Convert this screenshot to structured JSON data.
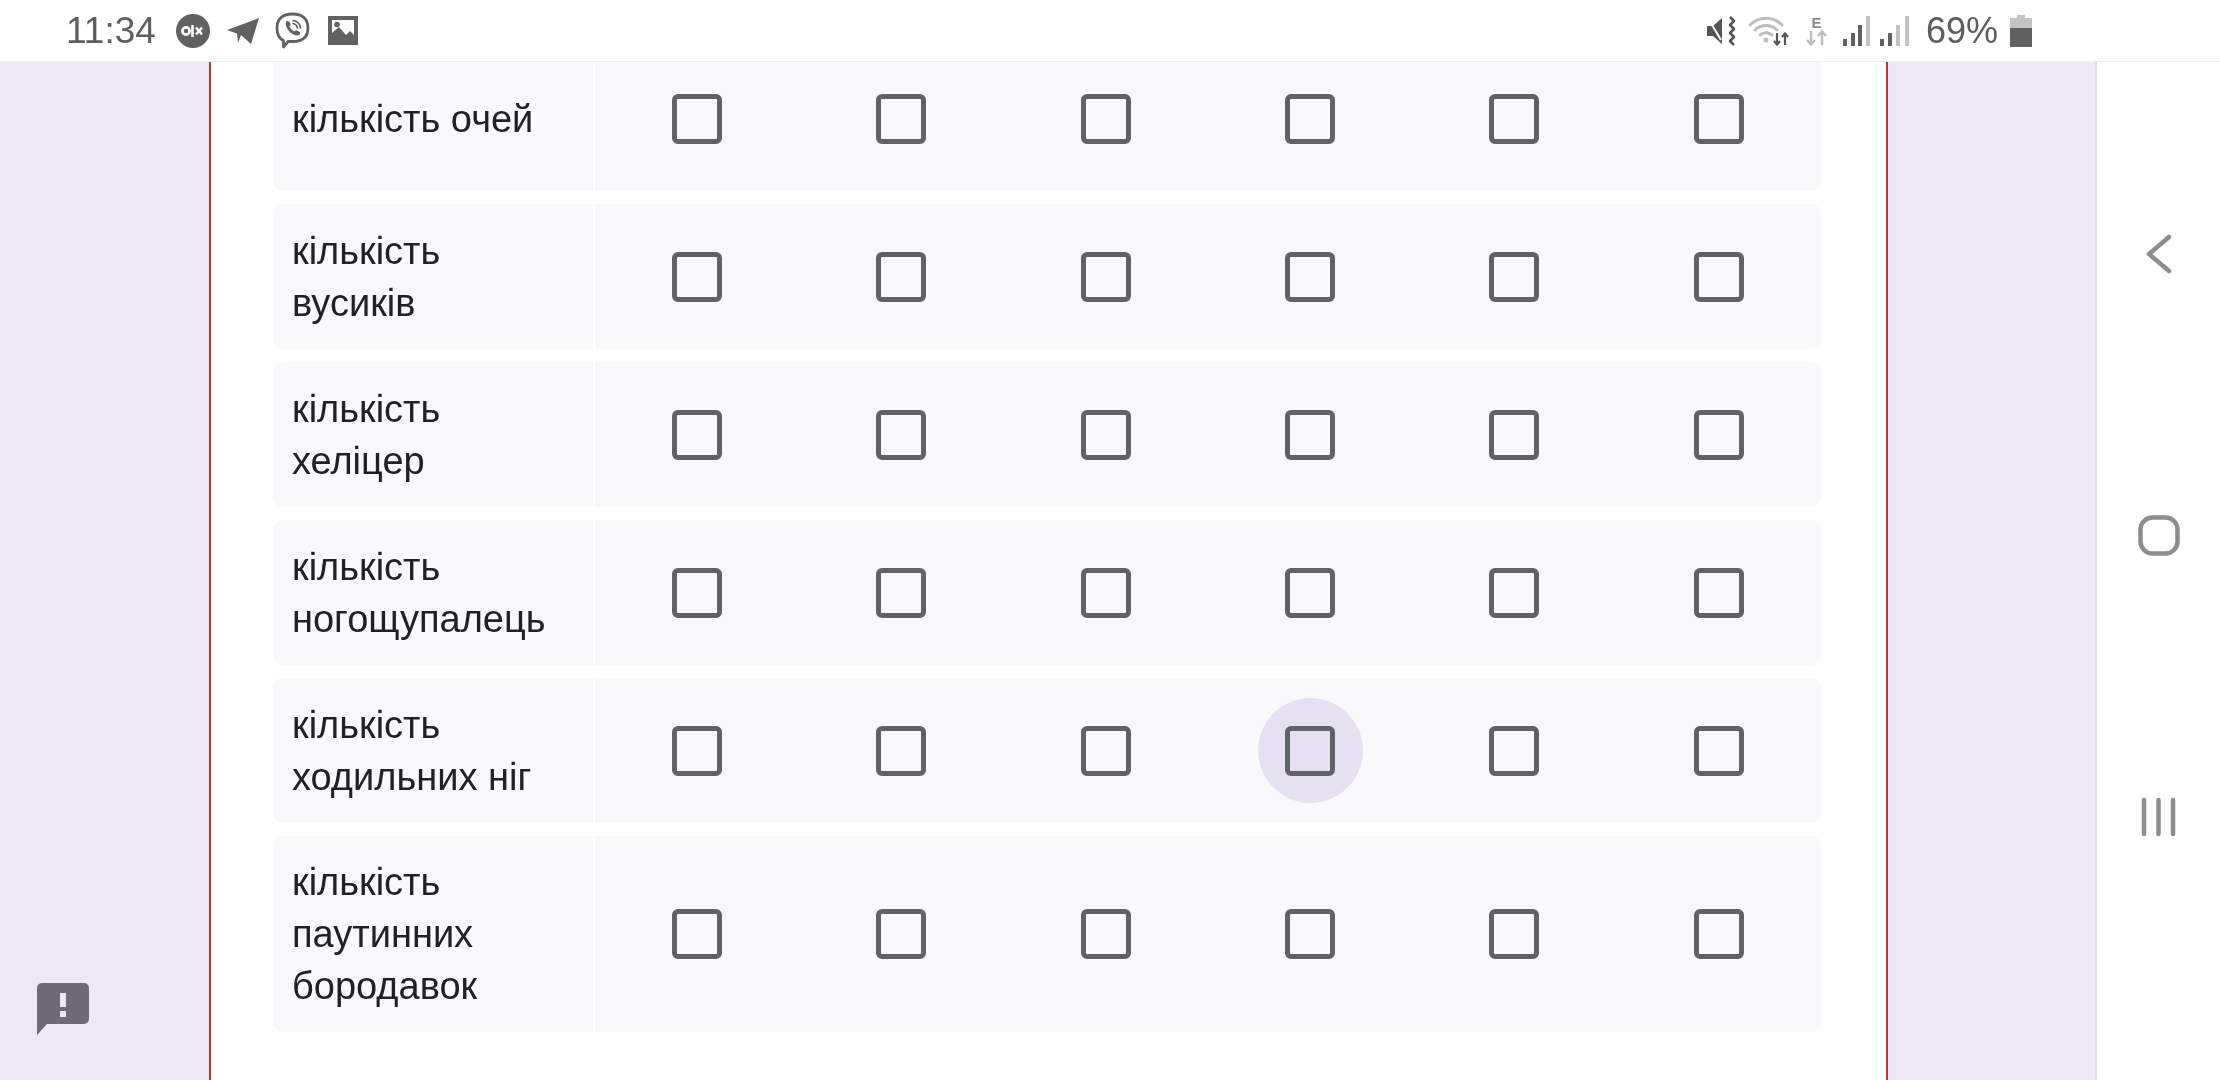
{
  "status_bar": {
    "time": "11:34",
    "network_type": "E",
    "battery": "69%"
  },
  "grid": {
    "rows": [
      {
        "label": "кількість очей",
        "cells": [
          {
            "checked": false,
            "focused": false
          },
          {
            "checked": false,
            "focused": false
          },
          {
            "checked": false,
            "focused": false
          },
          {
            "checked": false,
            "focused": false
          },
          {
            "checked": false,
            "focused": false
          },
          {
            "checked": false,
            "focused": false
          }
        ]
      },
      {
        "label": "кількість вусиків",
        "cells": [
          {
            "checked": false,
            "focused": false
          },
          {
            "checked": false,
            "focused": false
          },
          {
            "checked": false,
            "focused": false
          },
          {
            "checked": false,
            "focused": false
          },
          {
            "checked": false,
            "focused": false
          },
          {
            "checked": false,
            "focused": false
          }
        ]
      },
      {
        "label": "кількість хеліцер",
        "cells": [
          {
            "checked": false,
            "focused": false
          },
          {
            "checked": false,
            "focused": false
          },
          {
            "checked": false,
            "focused": false
          },
          {
            "checked": false,
            "focused": false
          },
          {
            "checked": false,
            "focused": false
          },
          {
            "checked": false,
            "focused": false
          }
        ]
      },
      {
        "label": "кількість ногощупалець",
        "cells": [
          {
            "checked": false,
            "focused": false
          },
          {
            "checked": false,
            "focused": false
          },
          {
            "checked": false,
            "focused": false
          },
          {
            "checked": false,
            "focused": false
          },
          {
            "checked": false,
            "focused": false
          },
          {
            "checked": false,
            "focused": false
          }
        ]
      },
      {
        "label": "кількість ходильних ніг",
        "cells": [
          {
            "checked": false,
            "focused": false
          },
          {
            "checked": false,
            "focused": false
          },
          {
            "checked": false,
            "focused": false
          },
          {
            "checked": false,
            "focused": true
          },
          {
            "checked": false,
            "focused": false
          },
          {
            "checked": false,
            "focused": false
          }
        ]
      },
      {
        "label": "кількість паутинних бородавок",
        "cells": [
          {
            "checked": false,
            "focused": false
          },
          {
            "checked": false,
            "focused": false
          },
          {
            "checked": false,
            "focused": false
          },
          {
            "checked": false,
            "focused": false
          },
          {
            "checked": false,
            "focused": false
          },
          {
            "checked": false,
            "focused": false
          }
        ]
      }
    ]
  }
}
